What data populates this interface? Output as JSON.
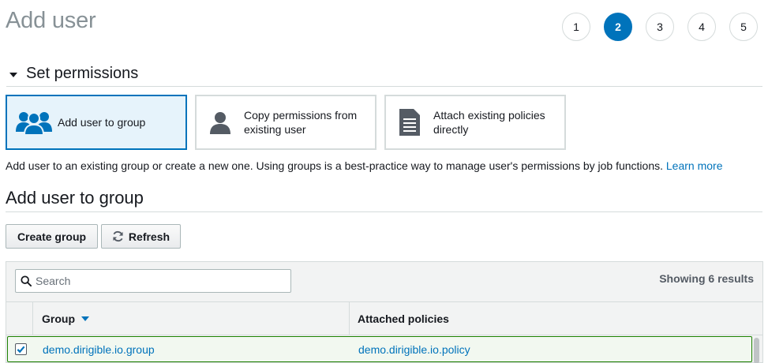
{
  "page": {
    "title": "Add user"
  },
  "steps": [
    {
      "label": "1",
      "active": false
    },
    {
      "label": "2",
      "active": true
    },
    {
      "label": "3",
      "active": false
    },
    {
      "label": "4",
      "active": false
    },
    {
      "label": "5",
      "active": false
    }
  ],
  "permissions": {
    "section_title": "Set permissions",
    "options": [
      {
        "label": "Add user to group",
        "icon": "group-icon",
        "selected": true
      },
      {
        "label": "Copy permissions from existing user",
        "icon": "user-icon",
        "selected": false
      },
      {
        "label": "Attach existing policies directly",
        "icon": "document-icon",
        "selected": false
      }
    ],
    "help_text": "Add user to an existing group or create a new one. Using groups is a best-practice way to manage user's permissions by job functions.",
    "learn_more": "Learn more"
  },
  "group_section": {
    "title": "Add user to group",
    "create_button": "Create group",
    "refresh_button": "Refresh",
    "search_placeholder": "Search",
    "results_text": "Showing 6 results",
    "columns": {
      "group": "Group",
      "policies": "Attached policies"
    },
    "rows": [
      {
        "group": "demo.dirigible.io.group",
        "policy": "demo.dirigible.io.policy",
        "checked": true
      }
    ]
  },
  "colors": {
    "accent": "#0073bb",
    "selected_row_border": "#1d8102",
    "title_gray": "#879196"
  }
}
